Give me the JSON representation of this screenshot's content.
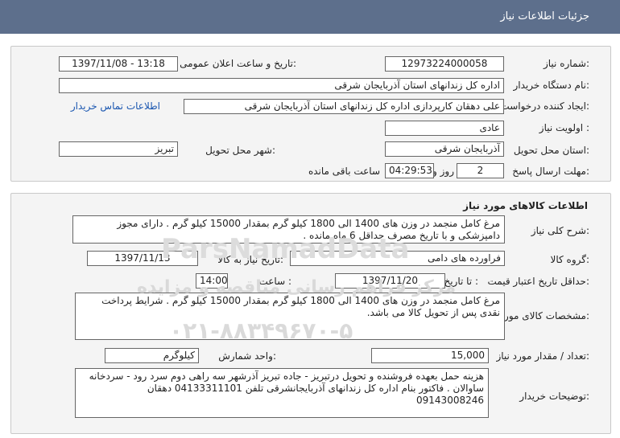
{
  "header": {
    "title": "جزئیات اطلاعات نیاز"
  },
  "info": {
    "need_number_label": "شماره نیاز:",
    "need_number": "12973224000058",
    "announce_label": "تاریخ و ساعت اعلان عمومی:",
    "announce_value": "1397/11/08 - 13:18",
    "buyer_org_label": "نام دستگاه خریدار:",
    "buyer_org": "اداره کل زندانهای استان آذربایجان شرقی",
    "requester_label": "ایجاد کننده درخواست:",
    "requester": "علی دهقان کارپردازی اداره کل زندانهای استان آذربایجان شرقی",
    "contact_link": "اطلاعات تماس خریدار",
    "priority_label": "اولویت نیاز :",
    "priority": "عادی",
    "province_label": "استان محل تحویل:",
    "province": "آذربایجان شرقی",
    "city_label": "شهر محل تحویل:",
    "city": "تبریز",
    "deadline_label": "مهلت ارسال پاسخ:",
    "days": "2",
    "days_word": "روز و",
    "time": "04:29:53",
    "time_suffix": "ساعت باقی مانده"
  },
  "goods": {
    "section_title": "اطلاعات کالاهای مورد نیاز",
    "desc_label": "شرح کلی نیاز:",
    "desc": "مرغ کامل منجمد در وزن های 1400 الی 1800 کیلو گرم بمقدار 15000 کیلو گرم . دارای مجوز دامپزشکی و با تاریخ مصرف حداقل 6 ماه مانده .",
    "group_label": "گروه کالا:",
    "group": "فراورده های دامی",
    "need_date_label": "تاریخ نیاز به کالا:",
    "need_date": "1397/11/13",
    "min_price_label": "حداقل تاریخ اعتبار قیمت:",
    "until_date_label": "تا تاریخ :",
    "until_date": "1397/11/20",
    "hour_label": "ساعت :",
    "hour": "14:00",
    "spec_label": "مشخصات کالای مورد نیاز:",
    "spec": "مرغ کامل منجمد در وزن های 1400 الی 1800 کیلو گرم بمقدار 15000 کیلو گرم . شرایط پرداخت نقدی پس از تحویل کالا می باشد.",
    "qty_label": "تعداد / مقدار مورد نیاز:",
    "qty": "15,000",
    "unit_label": "واحد شمارش:",
    "unit": "کیلوگرم",
    "notes_label": "توضیحات خریدار:",
    "notes": "هزینه حمل بعهده فروشنده و تحویل درتبریز - جاده تبریز آذرشهر سه راهی دوم سرد رود - سردخانه ساوالان . فاکتور بنام اداره کل زندانهای آذربایجانشرقی تلفن 04133311101 دهقان 09143008246"
  },
  "watermark": {
    "brand": "ParsNamadData",
    "caption": "مرکز فراهم رسانی مناقصه و مزایده",
    "phone": "۰۲۱-۸۸۳۴۹۶۷۰-۵"
  }
}
